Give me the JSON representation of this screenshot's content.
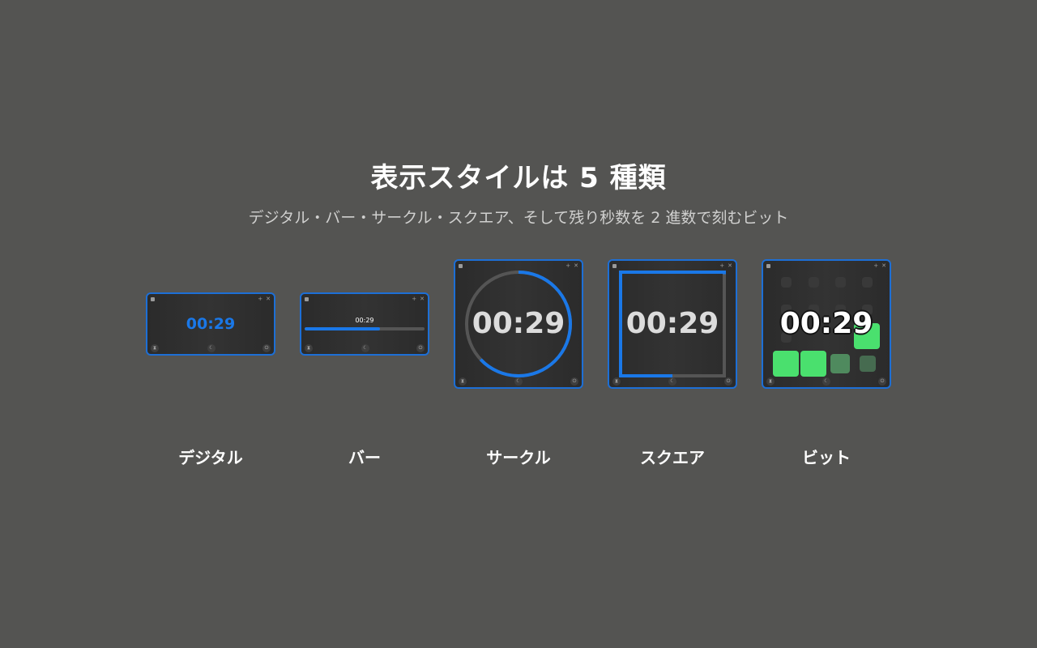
{
  "title": "表示スタイルは 5 種類",
  "subtitle": "デジタル・バー・サークル・スクエア、そして残り秒数を 2 進数で刻むビット",
  "time": "00:29",
  "progress_fraction": 0.63,
  "accent_color": "#1a78e8",
  "bit_color": "#4ae06e",
  "window_controls": [
    "+",
    "✕"
  ],
  "footer_icons": [
    "hourglass-icon",
    "moon-icon",
    "power-icon"
  ],
  "styles": [
    {
      "id": "digital",
      "label": "デジタル"
    },
    {
      "id": "bar",
      "label": "バー"
    },
    {
      "id": "circle",
      "label": "サークル"
    },
    {
      "id": "square",
      "label": "スクエア"
    },
    {
      "id": "bit",
      "label": "ビット"
    }
  ]
}
